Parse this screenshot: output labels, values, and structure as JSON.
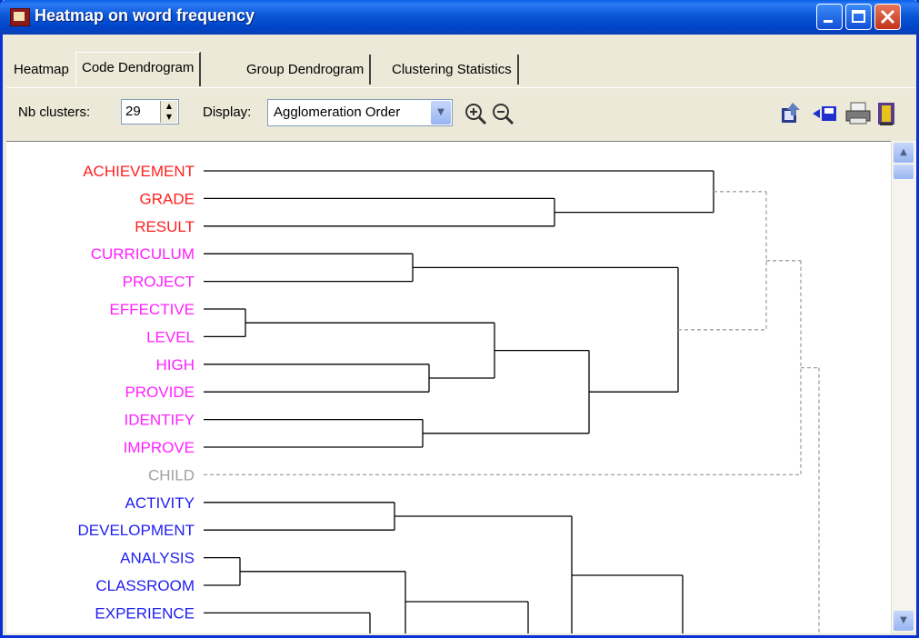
{
  "window": {
    "title": "Heatmap on word frequency"
  },
  "tabs": [
    {
      "label": "Heatmap"
    },
    {
      "label": "Code Dendrogram"
    },
    {
      "label": "Group Dendrogram"
    },
    {
      "label": "Clustering Statistics"
    }
  ],
  "toolbar": {
    "nb_clusters_label": "Nb clusters:",
    "nb_clusters_value": "29",
    "display_label": "Display:",
    "display_value": "Agglomeration Order"
  },
  "colors": {
    "red": "#ff2020",
    "magenta": "#ff20ff",
    "grey": "#a0a0a0",
    "blue": "#2020f0"
  },
  "icons": [
    "zoom-in-icon",
    "zoom-out-icon",
    "export-icon",
    "save-icon",
    "print-icon",
    "exit-icon"
  ],
  "dendrogram": {
    "leaves": [
      {
        "label": "ACHIEVEMENT",
        "color": "#ff2020"
      },
      {
        "label": "GRADE",
        "color": "#ff2020"
      },
      {
        "label": "RESULT",
        "color": "#ff2020"
      },
      {
        "label": "CURRICULUM",
        "color": "#ff20ff"
      },
      {
        "label": "PROJECT",
        "color": "#ff20ff"
      },
      {
        "label": "EFFECTIVE",
        "color": "#ff20ff"
      },
      {
        "label": "LEVEL",
        "color": "#ff20ff"
      },
      {
        "label": "HIGH",
        "color": "#ff20ff"
      },
      {
        "label": "PROVIDE",
        "color": "#ff20ff"
      },
      {
        "label": "IDENTIFY",
        "color": "#ff20ff"
      },
      {
        "label": "IMPROVE",
        "color": "#ff20ff"
      },
      {
        "label": "CHILD",
        "color": "#a0a0a0"
      },
      {
        "label": "ACTIVITY",
        "color": "#2020f0"
      },
      {
        "label": "DEVELOPMENT",
        "color": "#2020f0"
      },
      {
        "label": "ANALYSIS",
        "color": "#2020f0"
      },
      {
        "label": "CLASSROOM",
        "color": "#2020f0"
      },
      {
        "label": "EXPERIENCE",
        "color": "#2020f0"
      }
    ]
  }
}
